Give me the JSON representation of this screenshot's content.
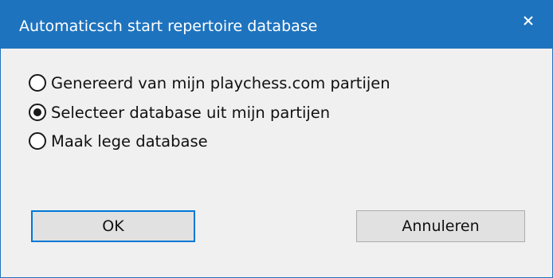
{
  "dialog": {
    "title": "Automaticsch start repertoire database",
    "close_icon": "close-icon",
    "options": [
      {
        "label": "Genereerd van mijn playchess.com partijen",
        "checked": false
      },
      {
        "label": "Selecteer database uit mijn partijen",
        "checked": true
      },
      {
        "label": "Maak lege database",
        "checked": false
      }
    ],
    "buttons": {
      "ok_label": "OK",
      "cancel_label": "Annuleren"
    }
  },
  "colors": {
    "titlebar": "#1e73be",
    "dialog_bg": "#f0f0f0",
    "button_bg": "#e1e1e1",
    "default_button_border": "#0078d7"
  }
}
